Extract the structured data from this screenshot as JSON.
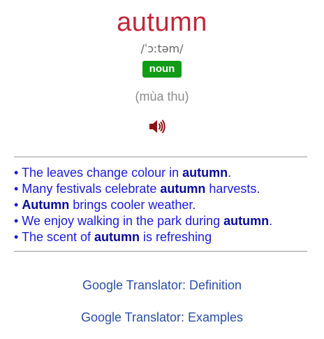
{
  "entry": {
    "word": "autumn",
    "pronunciation": "/ˈɔːtəm/",
    "part_of_speech": "noun",
    "translation": "(mùa thu)",
    "audio_icon": "speaker-icon"
  },
  "examples": [
    {
      "before": "• The leaves change colour in ",
      "bold": "autumn",
      "after": "."
    },
    {
      "before": "• Many festivals celebrate ",
      "bold": "autumn",
      "after": " harvests."
    },
    {
      "before": "• ",
      "bold": "Autumn",
      "after": " brings cooler weather."
    },
    {
      "before": "• We enjoy walking in the park during ",
      "bold": "autumn",
      "after": "."
    },
    {
      "before": "• The scent of ",
      "bold": "autumn",
      "after": " is refreshing"
    }
  ],
  "links": {
    "definition": "Google Translator: Definition",
    "examples": "Google Translator: Examples"
  },
  "colors": {
    "word": "#c0263a",
    "badge": "#119c15",
    "example_text": "#1a1adc",
    "link": "#2b4ea6",
    "speaker": "#8b1010"
  }
}
